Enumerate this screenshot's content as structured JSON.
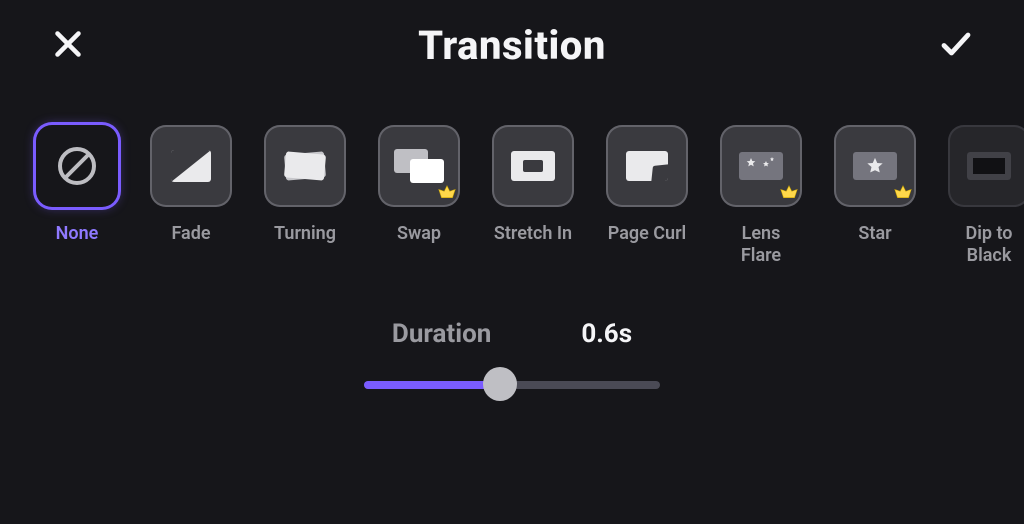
{
  "header": {
    "title": "Transition",
    "close_icon": "close-icon",
    "confirm_icon": "checkmark-icon"
  },
  "accent_color": "#7a5cff",
  "selected_index": 0,
  "transitions": [
    {
      "id": "none",
      "label": "None",
      "premium": false,
      "dim": false
    },
    {
      "id": "fade",
      "label": "Fade",
      "premium": false,
      "dim": false
    },
    {
      "id": "turning",
      "label": "Turning",
      "premium": false,
      "dim": false
    },
    {
      "id": "swap",
      "label": "Swap",
      "premium": true,
      "dim": false
    },
    {
      "id": "stretch-in",
      "label": "Stretch In",
      "premium": false,
      "dim": false
    },
    {
      "id": "page-curl",
      "label": "Page Curl",
      "premium": false,
      "dim": false
    },
    {
      "id": "lens-flare",
      "label": "Lens Flare",
      "premium": true,
      "dim": false
    },
    {
      "id": "star",
      "label": "Star",
      "premium": true,
      "dim": false
    },
    {
      "id": "dip-black",
      "label": "Dip to Black",
      "premium": false,
      "dim": true
    }
  ],
  "duration": {
    "label": "Duration",
    "value_text": "0.6s",
    "value_seconds": 0.6,
    "min_seconds": 0.1,
    "max_seconds": 1.5,
    "fill_percent": 46
  }
}
